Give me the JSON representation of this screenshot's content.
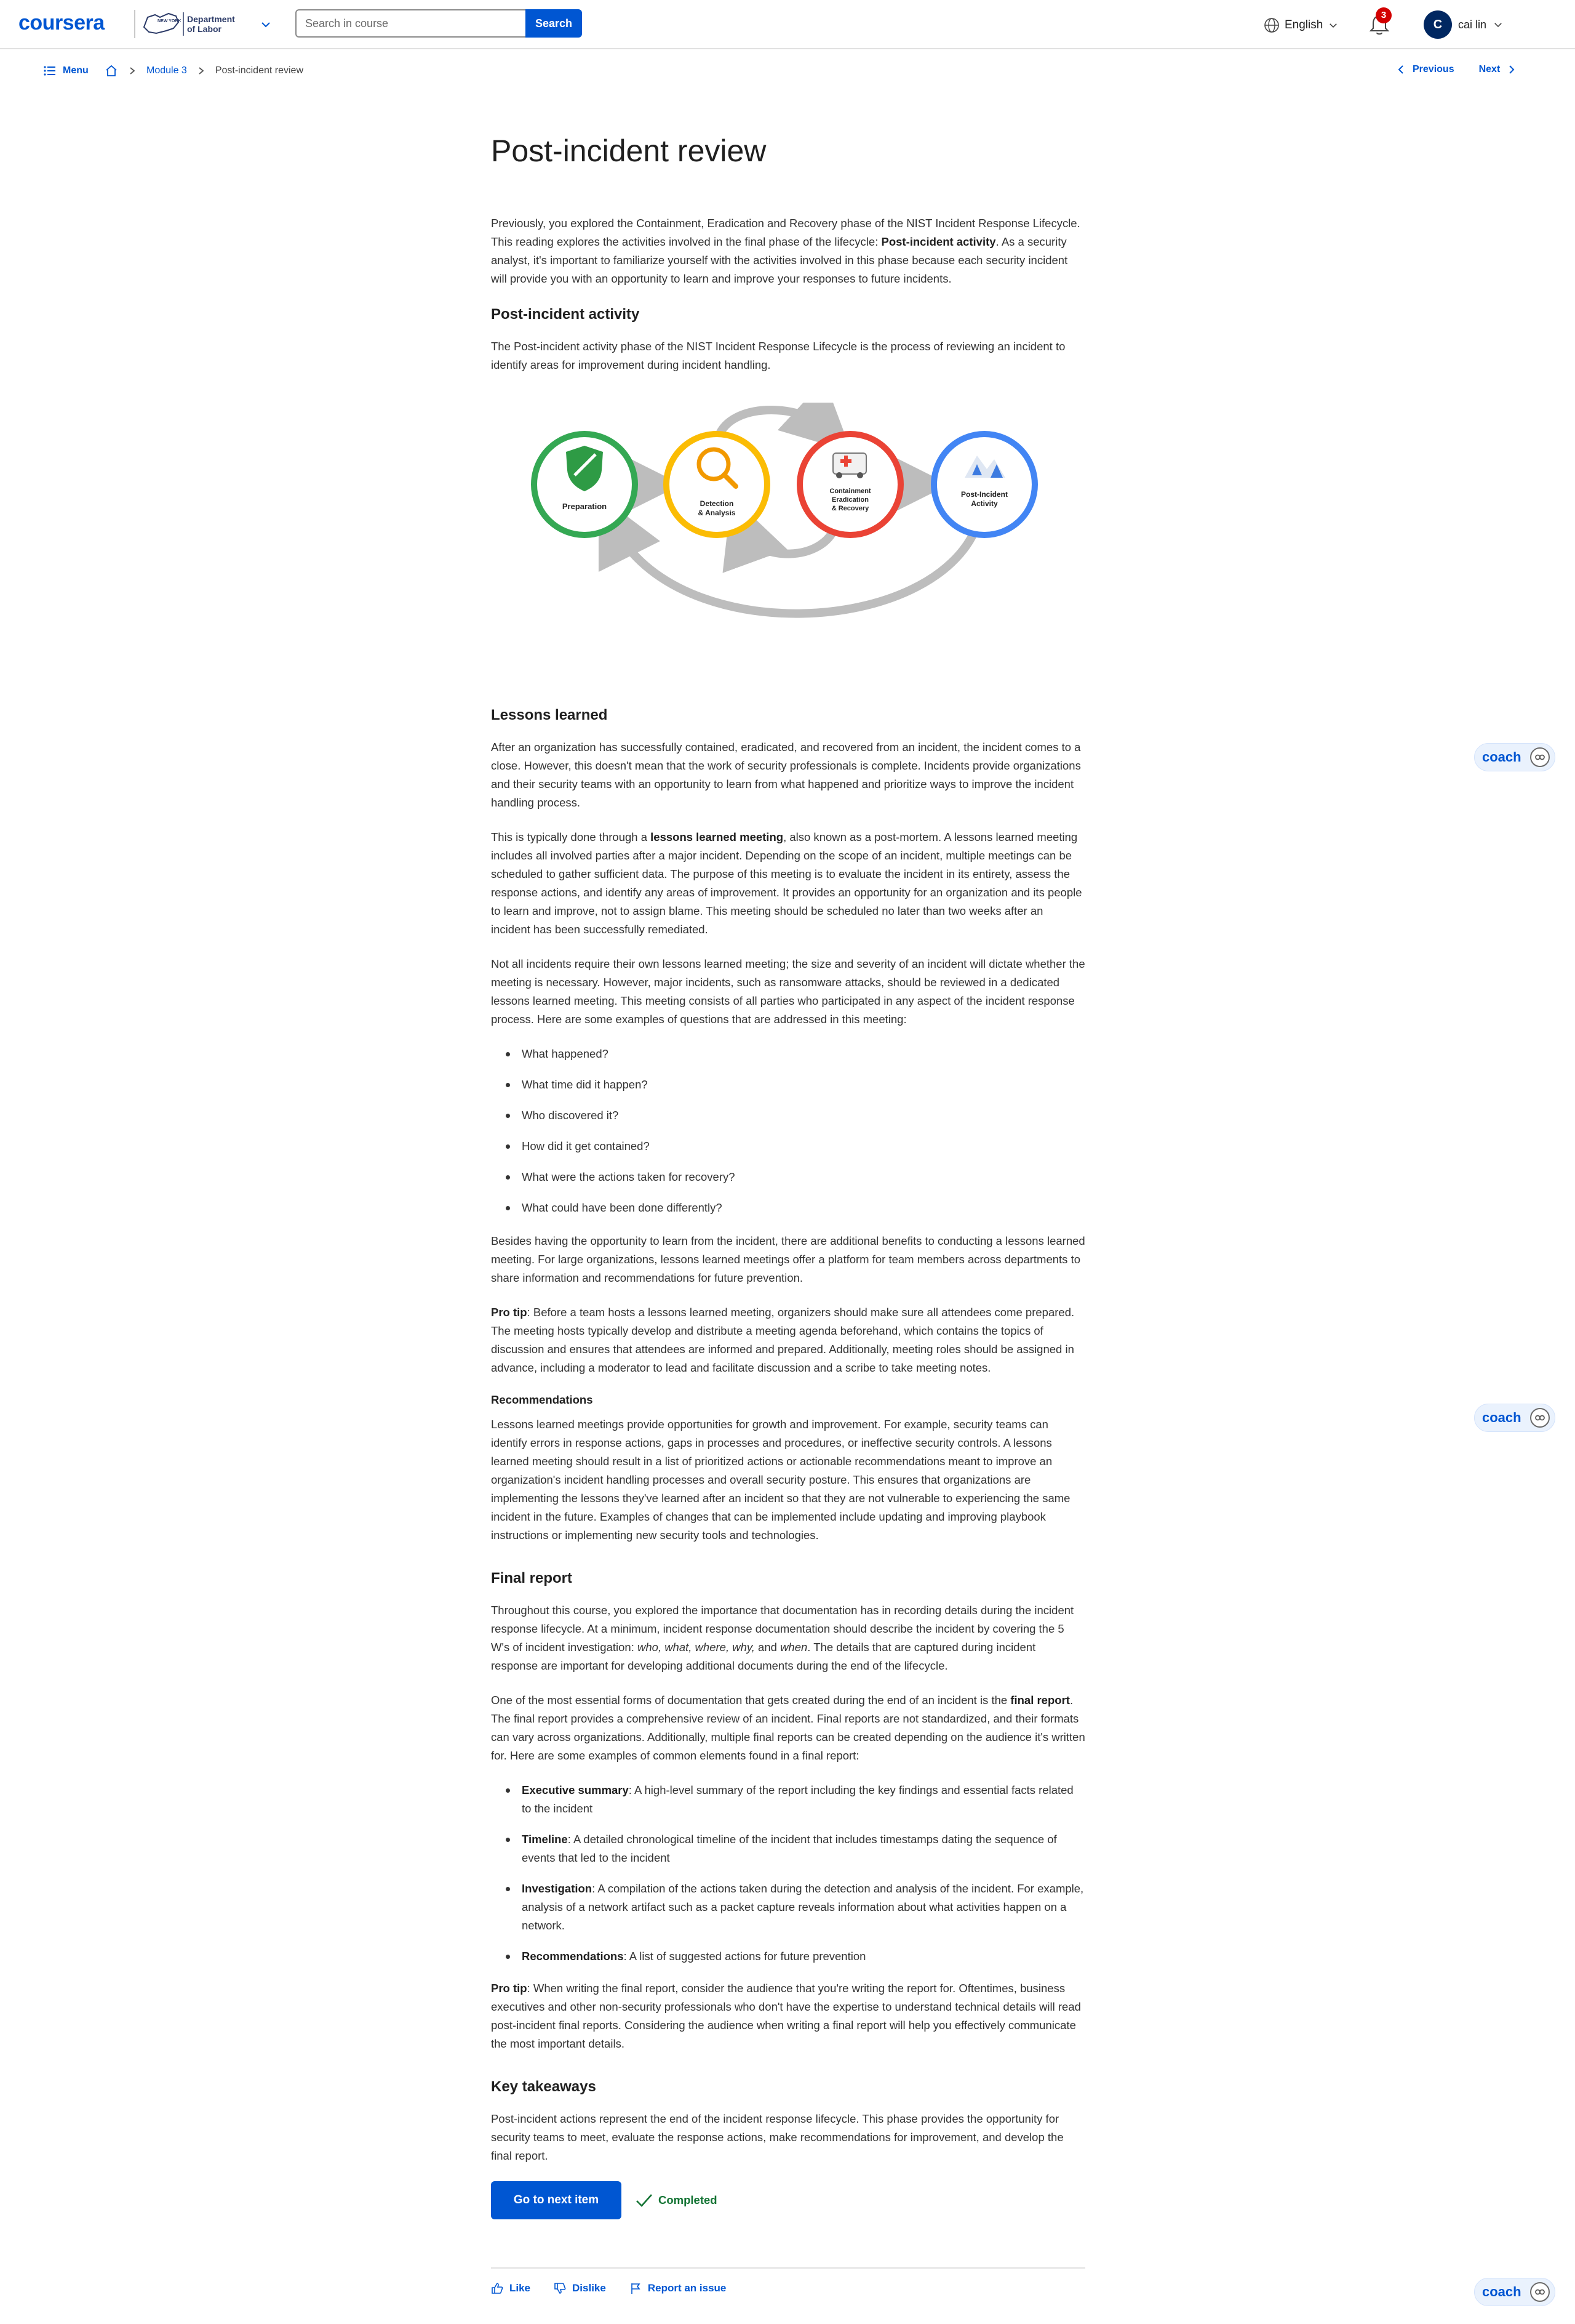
{
  "header": {
    "logo": "coursera",
    "partner_lines": [
      "NEW YORK",
      "Department",
      "of Labor"
    ],
    "search_placeholder": "Search in course",
    "search_button": "Search",
    "language": "English",
    "notification_count": "3",
    "user_initial": "C",
    "user_name": "cai lin"
  },
  "subnav": {
    "menu": "Menu",
    "breadcrumb_module": "Module 3",
    "breadcrumb_current": "Post-incident review",
    "previous": "Previous",
    "next": "Next"
  },
  "article": {
    "title": "Post-incident review",
    "intro_a": "Previously, you explored the Containment, Eradication and Recovery phase of the NIST Incident Response Lifecycle. This reading explores the activities involved in the final phase of the lifecycle: ",
    "intro_b": "Post-incident activity",
    "intro_c": ". As a security analyst, it's important to familiarize yourself with the activities involved in this phase because each security incident will provide you with an opportunity to learn and improve your responses to future incidents.",
    "h_post": "Post-incident activity",
    "p_post": "The Post-incident activity phase of the NIST Incident Response Lifecycle is the process of reviewing an incident to identify areas for improvement during incident handling.",
    "diagram": {
      "preparation": "Preparation",
      "detection": [
        "Detection",
        "& Analysis"
      ],
      "containment": [
        "Containment",
        "Eradication",
        "& Recovery"
      ],
      "post": [
        "Post-Incident",
        "Activity"
      ],
      "colors": {
        "preparation": "#34a853",
        "detection": "#fbbc04",
        "containment": "#ea4335",
        "post": "#4285f4",
        "arrows": "#bdbdbd"
      }
    },
    "h_lessons": "Lessons learned",
    "p_lessons1": "After an organization has successfully contained, eradicated, and recovered from an incident, the incident comes to a close. However, this doesn't mean that the work of security professionals is complete. Incidents provide organizations and their security teams with an opportunity to learn from what happened and prioritize ways to improve the incident handling process.",
    "p_lessons2_a": "This is typically done through a ",
    "p_lessons2_b": "lessons learned meeting",
    "p_lessons2_c": ", also known as a post-mortem. A lessons learned meeting includes all involved parties after a major incident. Depending on the scope of an incident, multiple meetings can be scheduled to gather sufficient data. The purpose of this meeting is to evaluate the incident in its entirety, assess the response actions, and identify any areas of improvement. It provides an opportunity for an organization and its people to learn and improve, not to assign blame. This meeting should be scheduled no later than two weeks after an incident has been successfully remediated.",
    "p_lessons3": "Not all incidents require their own lessons learned meeting; the size and severity of an incident will dictate whether the meeting is necessary. However, major incidents, such as ransomware attacks, should be reviewed in a dedicated lessons learned meeting. This meeting consists of all parties who participated in any aspect of the incident response process. Here are some examples of questions that are addressed in this meeting:",
    "questions": [
      "What happened?",
      "What time did it happen?",
      "Who discovered it?",
      "How did it get contained?",
      "What were the actions taken for recovery?",
      "What could have been done differently?"
    ],
    "p_benefits": "Besides having the opportunity to learn from the incident, there are additional benefits to conducting a lessons learned meeting. For large organizations, lessons learned meetings offer a platform for team members across departments to share information and recommendations for future prevention.",
    "pro_tip_label": "Pro tip",
    "pro_tip1": ": Before a team hosts a lessons learned meeting, organizers should make sure all attendees come prepared. The meeting hosts typically develop and distribute a meeting agenda beforehand, which contains the topics of discussion and ensures that attendees are informed and prepared. Additionally, meeting roles should be assigned in advance, including a moderator to lead and facilitate discussion and a scribe to take meeting notes.",
    "h_recommendations": "Recommendations",
    "p_recommendations": "Lessons learned meetings provide opportunities for growth and improvement. For example, security teams can identify errors in response actions, gaps in processes and procedures, or ineffective security controls. A lessons learned meeting should result in a list of prioritized actions or actionable recommendations meant to improve an organization's incident handling processes and overall security posture. This ensures that organizations are implementing the lessons they've learned after an incident so that they are not vulnerable to experiencing the same incident in the future. Examples of changes that can be implemented include updating and improving playbook instructions or implementing new security tools and technologies.",
    "h_final": "Final report",
    "p_final1_a": "Throughout this course, you explored the importance that documentation has in recording details during the incident response lifecycle. At a minimum, incident response documentation should describe the incident by covering the 5 W's of incident investigation: ",
    "p_final1_w1": "who, what, where, why,",
    "p_final1_and": " and ",
    "p_final1_w2": "when",
    "p_final1_b": ". The details that are captured during incident response are important for developing additional documents during the end of the lifecycle.",
    "p_final2_a": "One of the most essential forms of documentation that gets created during the end of an incident is the ",
    "p_final2_b": "final report",
    "p_final2_c": ". The final report provides a comprehensive review of an incident. Final reports are not standardized, and their formats can vary across organizations. Additionally, multiple final reports can be created depending on the audience it's written for. Here are some examples of common elements found in a final report:",
    "elements": [
      {
        "term": "Executive summary",
        "text": ": A high-level summary of the report including the key findings and essential facts related to the incident"
      },
      {
        "term": "Timeline",
        "text": ":  A detailed chronological timeline of the incident that includes timestamps dating the sequence of events that led to the incident"
      },
      {
        "term": "Investigation",
        "text": ": A compilation of the actions taken during the detection and analysis of the incident. For example, analysis of a network artifact such as a packet capture reveals information about what activities happen on a network."
      },
      {
        "term": "Recommendations",
        "text": ": A list of suggested actions for future prevention"
      }
    ],
    "pro_tip2": ": When writing the final report, consider the audience that you're writing the report for. Oftentimes, business executives and other non-security professionals who don't have the expertise to understand technical details will read post-incident final reports. Considering the audience when writing a final report will help you effectively communicate the most important details.",
    "h_key": "Key takeaways",
    "p_key": "Post-incident actions represent the end of the incident response lifecycle. This phase provides the opportunity for security teams to meet, evaluate the response actions, make recommendations for improvement, and develop the final report."
  },
  "actions": {
    "next_item": "Go to next item",
    "completed": "Completed",
    "like": "Like",
    "dislike": "Dislike",
    "report": "Report an issue"
  },
  "coach": {
    "label": "coach"
  }
}
